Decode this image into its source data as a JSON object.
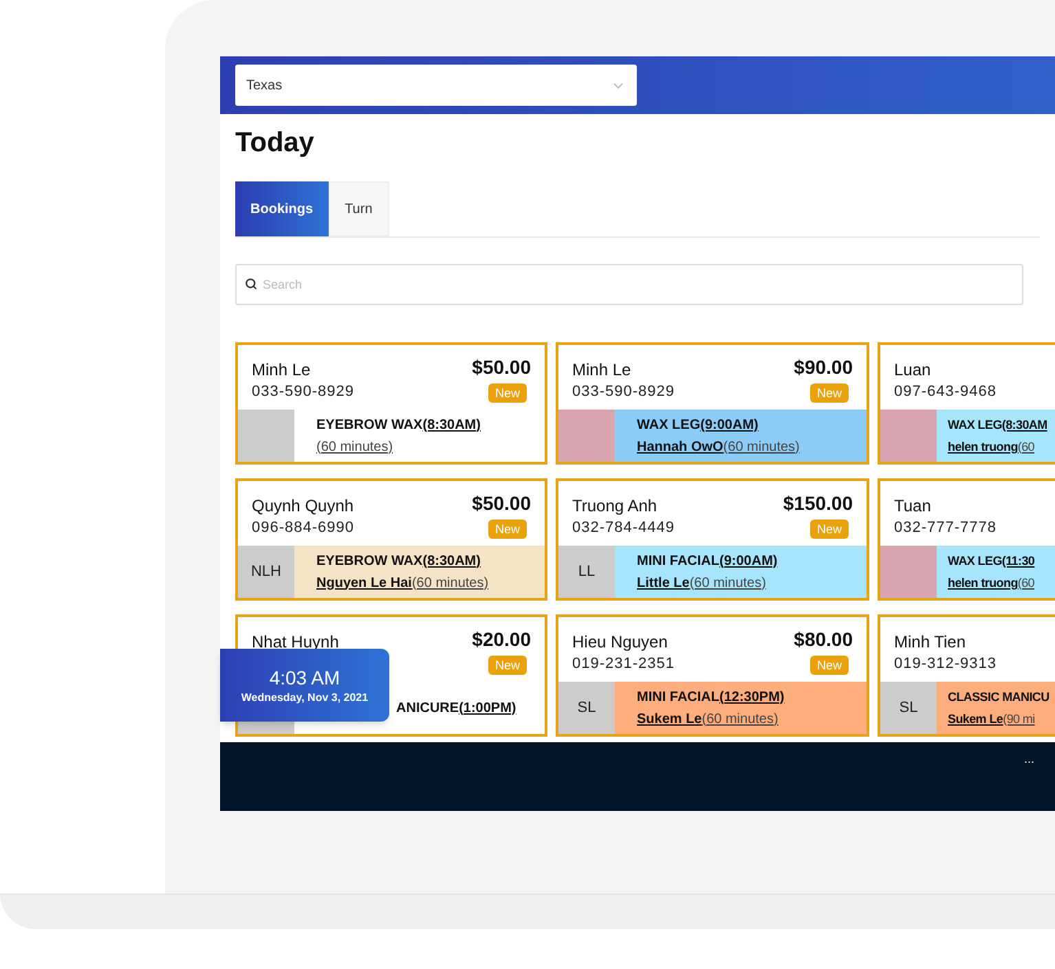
{
  "location_select": {
    "value": "Texas"
  },
  "title": "Today",
  "tabs": [
    {
      "label": "Bookings",
      "selected": true
    },
    {
      "label": "Turn",
      "selected": false
    }
  ],
  "search": {
    "placeholder": "Search"
  },
  "bookings": [
    {
      "name": "Minh Le",
      "phone": "033-590-8929",
      "price": "$50.00",
      "badge": "New",
      "staff_thumb": {
        "kind": "blank"
      },
      "service": "EYEBROW WAX",
      "time": "(8:30AM)",
      "duration": "(60 minutes)",
      "color": "#ffffff"
    },
    {
      "name": "Minh Le",
      "phone": "033-590-8929",
      "price": "$90.00",
      "badge": "New",
      "staff_thumb": {
        "kind": "photo"
      },
      "service": "WAX LEG",
      "time": "(9:00AM)",
      "staff": "Hannah OwO",
      "duration": "(60 minutes)",
      "color": "#8ccdf8"
    },
    {
      "name": "Luan",
      "phone": "097-643-9468",
      "staff_thumb": {
        "kind": "photo"
      },
      "service": "WAX LEG",
      "time": "(8:30AM",
      "staff": "helen truong",
      "duration": "(60",
      "color": "#a6e5fb"
    },
    {
      "name": "Quynh Quynh",
      "phone": "096-884-6990",
      "price": "$50.00",
      "badge": "New",
      "staff_thumb": {
        "kind": "initials",
        "initials": "NLH"
      },
      "service": "EYEBROW WAX",
      "time": "(8:30AM)",
      "staff": "Nguyen Le Hai",
      "duration": "(60 minutes)",
      "color": "#f5e3c6"
    },
    {
      "name": "Truong Anh",
      "phone": "032-784-4449",
      "price": "$150.00",
      "badge": "New",
      "staff_thumb": {
        "kind": "initials",
        "initials": "LL"
      },
      "service": "MINI FACIAL",
      "time": "(9:00AM)",
      "staff": "Little Le",
      "duration": "(60 minutes)",
      "color": "#a6e5fb"
    },
    {
      "name": "Tuan",
      "phone": "032-777-7778",
      "staff_thumb": {
        "kind": "photo"
      },
      "service": "WAX LEG",
      "time": "(11:30",
      "staff": "helen truong",
      "duration": "(60",
      "color": "#a6e5fb"
    },
    {
      "name": "Nhat Huynh",
      "price": "$20.00",
      "badge": "New",
      "staff_thumb": {
        "kind": "blank"
      },
      "service": "ANICURE",
      "time": "(1:00PM)",
      "color": "#ffffff"
    },
    {
      "name": "Hieu Nguyen",
      "phone": "019-231-2351",
      "price": "$80.00",
      "badge": "New",
      "staff_thumb": {
        "kind": "initials",
        "initials": "SL"
      },
      "service": "MINI FACIAL",
      "time": "(12:30PM)",
      "staff": "Sukem Le",
      "duration": "(60 minutes)",
      "color": "#fdae7c"
    },
    {
      "name": "Minh Tien",
      "phone": "019-312-9313",
      "staff_thumb": {
        "kind": "initials",
        "initials": "SL"
      },
      "service": "CLASSIC MANICU",
      "staff": "Sukem Le",
      "duration": "(90 mi",
      "color": "#fdae7c"
    }
  ],
  "clock": {
    "time": "4:03 AM",
    "date": "Wednesday, Nov 3, 2021"
  },
  "footer": {
    "more": "..."
  }
}
